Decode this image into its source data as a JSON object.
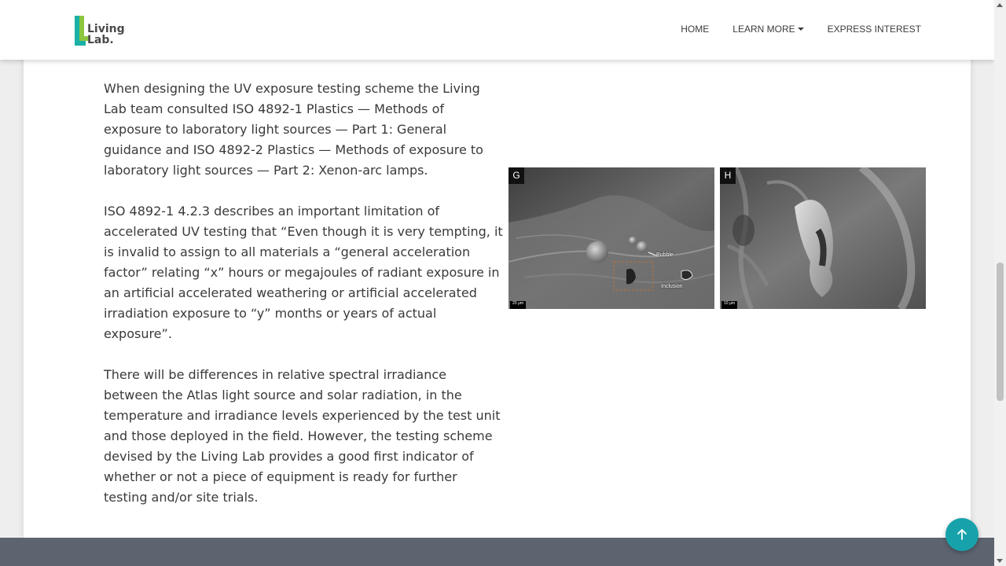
{
  "brand": {
    "logo_line1": "Living",
    "logo_line2": "Lab.",
    "colors": {
      "logo_green": "#8cc63f",
      "logo_teal": "#1ab0a6",
      "accent": "#17a2ab"
    }
  },
  "nav": {
    "items": [
      {
        "label": "HOME",
        "has_dropdown": false
      },
      {
        "label": "LEARN MORE",
        "has_dropdown": true
      },
      {
        "label": "EXPRESS INTEREST",
        "has_dropdown": false
      }
    ]
  },
  "content": {
    "paragraphs": [
      "When designing the UV exposure testing scheme the Living Lab team consulted ISO 4892-1 Plastics — Methods of exposure to laboratory light sources — Part 1: General guidance and ISO 4892-2 Plastics — Methods of exposure to laboratory light sources — Part 2: Xenon-arc lamps.",
      "ISO 4892-1 4.2.3 describes an important limitation of accelerated UV testing that “Even though it is very tempting, it is invalid to assign to all materials a “general acceleration factor” relating “x” hours or megajoules of radiant exposure in an artificial accelerated weathering or artificial accelerated irradiation exposure to “y” months or years of actual exposure”.",
      "There will be differences in relative spectral irradiance between the Atlas light source and solar radiation, in the temperature and irradiance levels experienced by the test unit and those deployed in the field. However, the testing scheme devised by the Living Lab provides a good first indicator of whether or not a piece of equipment is ready for further testing and/or site trials."
    ]
  },
  "figure": {
    "panels": [
      {
        "label": "G",
        "scale_text": "20 µm",
        "annotations": [
          "Bubble",
          "Inclusion"
        ]
      },
      {
        "label": "H",
        "scale_text": "10 µm",
        "annotations": []
      }
    ]
  },
  "icons": {
    "back_to_top": "arrow-up-icon",
    "dropdown": "caret-down-icon"
  }
}
